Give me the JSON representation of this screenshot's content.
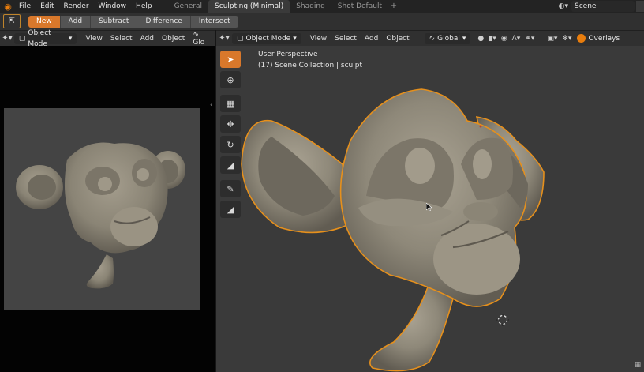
{
  "topbar": {
    "logo_icon": "blender-logo-icon",
    "menus": [
      "File",
      "Edit",
      "Render",
      "Window",
      "Help"
    ],
    "workspace_tabs": [
      "General",
      "Sculpting (Minimal)",
      "Shading",
      "Shot Default"
    ],
    "active_tab": "Sculpting (Minimal)",
    "add_tab": "+",
    "scene_label": "Scene"
  },
  "tool_settings": {
    "tool_icon": "select-box-icon",
    "modes": [
      "New",
      "Add",
      "Subtract",
      "Difference",
      "Intersect"
    ],
    "active_mode": "New"
  },
  "left_editor": {
    "mode": "Object Mode",
    "menus": [
      "View",
      "Select",
      "Add",
      "Object"
    ],
    "cut_label": "Glo"
  },
  "right_editor": {
    "mode": "Object Mode",
    "menus": [
      "View",
      "Select",
      "Add",
      "Object"
    ],
    "orientation": "Global",
    "overlays": "Overlays",
    "viewport_title": "User Perspective",
    "viewport_subtitle": "(17) Scene Collection | sculpt"
  },
  "toolbar_tools": [
    "select-cursor-icon",
    "cursor-3d-icon",
    "move-icon",
    "translate-icon",
    "rotate-icon",
    "scale-icon",
    "annotate-icon",
    "measure-icon"
  ],
  "colors": {
    "accent": "#d9782b",
    "selection_outline": "#e6901c",
    "viewport_bg": "#3a3a3a",
    "clay": "#8c8677"
  }
}
